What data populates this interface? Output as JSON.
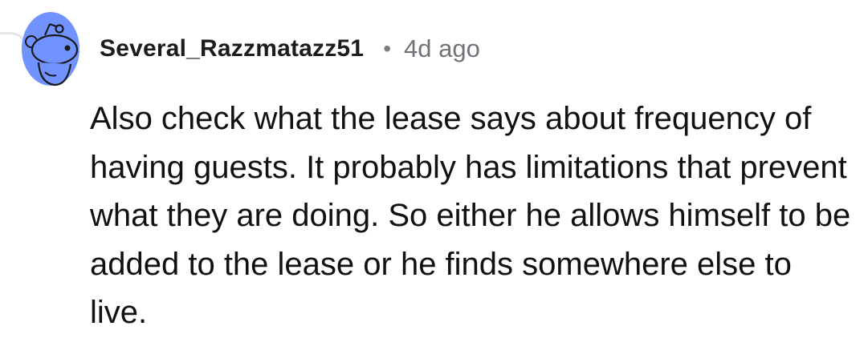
{
  "comment": {
    "username": "Several_Razzmatazz51",
    "separator": "•",
    "timestamp": "4d ago",
    "avatar_icon": "snoo-avatar-icon",
    "avatar_color": "#7193FF",
    "body": "Also check what the lease says about frequency of having guests. It probably has limitations that prevent what they are doing. So either he allows himself to be added to the lease or he finds somewhere else to live."
  }
}
